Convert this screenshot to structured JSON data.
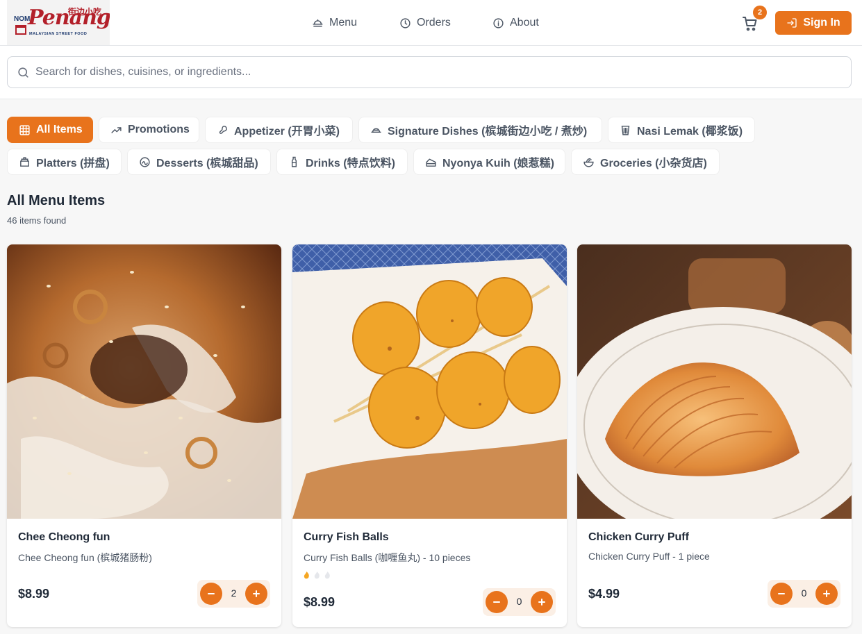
{
  "brand": {
    "logo_nom": "NOM",
    "logo_script": "Penang",
    "logo_cn": "街边小吃",
    "logo_sub": "MALAYSIAN STREET FOOD"
  },
  "nav": {
    "menu": "Menu",
    "orders": "Orders",
    "about": "About"
  },
  "cart": {
    "count": "2"
  },
  "signin": "Sign In",
  "search": {
    "placeholder": "Search for dishes, cuisines, or ingredients...",
    "value": ""
  },
  "categories": [
    {
      "label": "All Items",
      "icon": "grid-icon",
      "active": true
    },
    {
      "label": "Promotions",
      "icon": "trending-up-icon",
      "active": false
    },
    {
      "label": "Appetizer (开胃小菜)",
      "icon": "drumstick-icon",
      "active": false
    },
    {
      "label": "Signature Dishes (槟城街边小吃 / 煮炒)",
      "icon": "dish-icon",
      "active": false
    },
    {
      "label": "Nasi Lemak (椰浆饭)",
      "icon": "cup-icon",
      "active": false
    },
    {
      "label": "Platters (拼盘)",
      "icon": "platter-icon",
      "active": false
    },
    {
      "label": "Desserts (槟城甜品)",
      "icon": "dessert-icon",
      "active": false
    },
    {
      "label": "Drinks (特点饮料)",
      "icon": "bottle-icon",
      "active": false
    },
    {
      "label": "Nyonya Kuih (娘惹糕)",
      "icon": "cake-slice-icon",
      "active": false
    },
    {
      "label": "Groceries (小杂货店)",
      "icon": "bowl-icon",
      "active": false
    }
  ],
  "section": {
    "title": "All Menu Items",
    "count": "46 items found"
  },
  "items": [
    {
      "name": "Chee Cheong fun",
      "description": "Chee Cheong fun (槟城猪肠粉)",
      "price": "$8.99",
      "quantity": "2",
      "spice_level": 0
    },
    {
      "name": "Curry Fish Balls",
      "description": "Curry Fish Balls (咖喱鱼丸) - 10 pieces",
      "price": "$8.99",
      "quantity": "0",
      "spice_level": 1
    },
    {
      "name": "Chicken Curry Puff",
      "description": "Chicken Curry Puff - 1 piece",
      "price": "$4.99",
      "quantity": "0",
      "spice_level": 0
    }
  ],
  "colors": {
    "accent": "#e8731c",
    "stepper_bg": "#fbefe5",
    "text": "#1f2937",
    "muted": "#4b5563"
  }
}
